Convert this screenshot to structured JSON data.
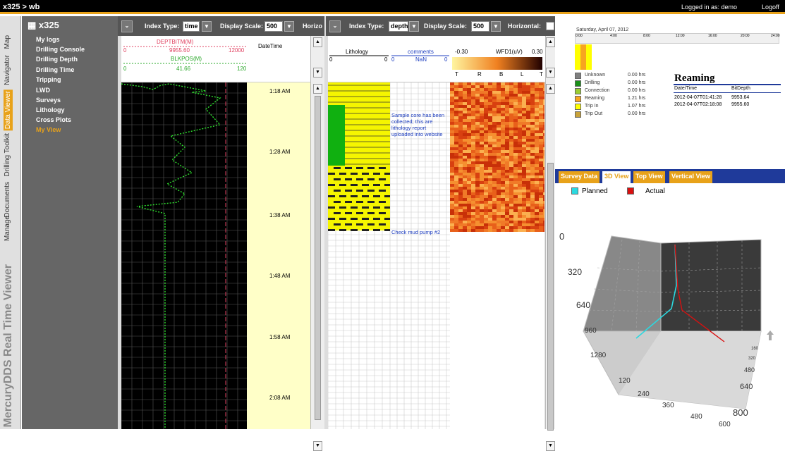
{
  "topbar": {
    "breadcrumb": "x325 > wb",
    "login": "Logged in as: demo",
    "logoff": "Logoff"
  },
  "vtabs": [
    "Map",
    "Navigator",
    "Data Viewer",
    "Drilling Toolkit",
    "Documents",
    "Manage"
  ],
  "brand": "MercuryDDS Real Time Viewer",
  "nav": {
    "title": "x325",
    "items": [
      "My logs",
      "Drilling Console",
      "Drilling Depth",
      "Drilling Time",
      "Tripping",
      "LWD",
      "Surveys",
      "Lithology",
      "Cross Plots",
      "My View"
    ]
  },
  "time_panel": {
    "index_type_label": "Index Type:",
    "index_type_value": "time",
    "display_scale_label": "Display Scale:",
    "display_scale_value": "500",
    "horizontal_label": "Horizo",
    "curve1": {
      "name": "DEPTBITM(M)",
      "min": "0",
      "max": "12000",
      "value": "9955.60"
    },
    "curve2": {
      "name": "BLKPOS(M)",
      "min": "0",
      "max": "120",
      "value": "41.66"
    },
    "date_col": "DateTime",
    "times": [
      "1:18 AM",
      "1:28 AM",
      "1:38 AM",
      "1:48 AM",
      "1:58 AM",
      "2:08 AM"
    ]
  },
  "depth_panel": {
    "index_type_label": "Index Type:",
    "index_type_value": "depth",
    "display_scale_label": "Display Scale:",
    "display_scale_value": "500",
    "horizontal_label": "Horizontal:",
    "lithology": {
      "name": "Lithology",
      "min": "0",
      "max": "0"
    },
    "comments": {
      "name": "comments",
      "min": "0",
      "max": "0",
      "value": "NaN"
    },
    "wfd": {
      "name": "WFD1(uV)",
      "min": "-0.30",
      "max": "0.30",
      "letters": [
        "T",
        "R",
        "B",
        "L",
        "T"
      ]
    },
    "comment1": "Sample core has been collected; this are lithology report uploaded into website",
    "comment2": "Check mud pump #2"
  },
  "activity": {
    "date": "Saturday, April 07, 2012",
    "hours": [
      "0:00",
      "4:00",
      "8:00",
      "12:00",
      "16:00",
      "20:00",
      "24:00"
    ],
    "states": [
      {
        "name": "Unknown",
        "hrs": "0.00 hrs",
        "color": "#7f7f7f"
      },
      {
        "name": "Drilling",
        "hrs": "0.00 hrs",
        "color": "#1a8f1a"
      },
      {
        "name": "Connection",
        "hrs": "0.00 hrs",
        "color": "#9acd32"
      },
      {
        "name": "Reaming",
        "hrs": "1.21 hrs",
        "color": "#f7a51f"
      },
      {
        "name": "Trip In",
        "hrs": "1.07 hrs",
        "color": "#ffff00"
      },
      {
        "name": "Trip Out",
        "hrs": "0.00 hrs",
        "color": "#c8a23a"
      }
    ],
    "section_title": "Reaming",
    "table_headers": [
      "Date/Time",
      "BitDepth"
    ],
    "rows": [
      [
        "2012-04-07T01:41:28",
        "9953.64"
      ],
      [
        "2012-04-07T02:18:08",
        "9955.60"
      ]
    ]
  },
  "view3d": {
    "tabs": [
      "Survey Data",
      "3D View",
      "Top View",
      "Vertical View"
    ],
    "active_tab": "3D View",
    "legend": [
      {
        "name": "Planned",
        "color": "#2bd9e0"
      },
      {
        "name": "Actual",
        "color": "#d91010"
      }
    ],
    "axis_top": "0",
    "axis_depth": [
      "320",
      "640",
      "960",
      "1280"
    ],
    "axis_x": [
      "120",
      "240",
      "360",
      "480",
      "600"
    ],
    "axis_y": [
      "160",
      "320",
      "480",
      "640",
      "800"
    ]
  }
}
